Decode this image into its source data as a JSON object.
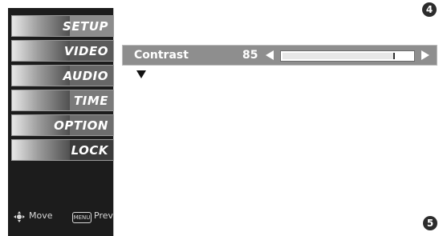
{
  "sidebar": {
    "items": [
      {
        "label": "SETUP",
        "icon": "satellite-dish-icon"
      },
      {
        "label": "VIDEO",
        "icon": "film-reel-icon"
      },
      {
        "label": "AUDIO",
        "icon": "speaker-icon"
      },
      {
        "label": "TIME",
        "icon": "clock-icon"
      },
      {
        "label": "OPTION",
        "icon": "option-tag-icon"
      },
      {
        "label": "LOCK",
        "icon": "padlock-icon"
      }
    ],
    "footer": {
      "move_label": "Move",
      "menu_key": "MENU",
      "prev_label": "Prev"
    }
  },
  "contrast": {
    "label": "Contrast",
    "value": "85",
    "level": 0.85
  },
  "badges": {
    "top": "4",
    "bottom": "5"
  }
}
